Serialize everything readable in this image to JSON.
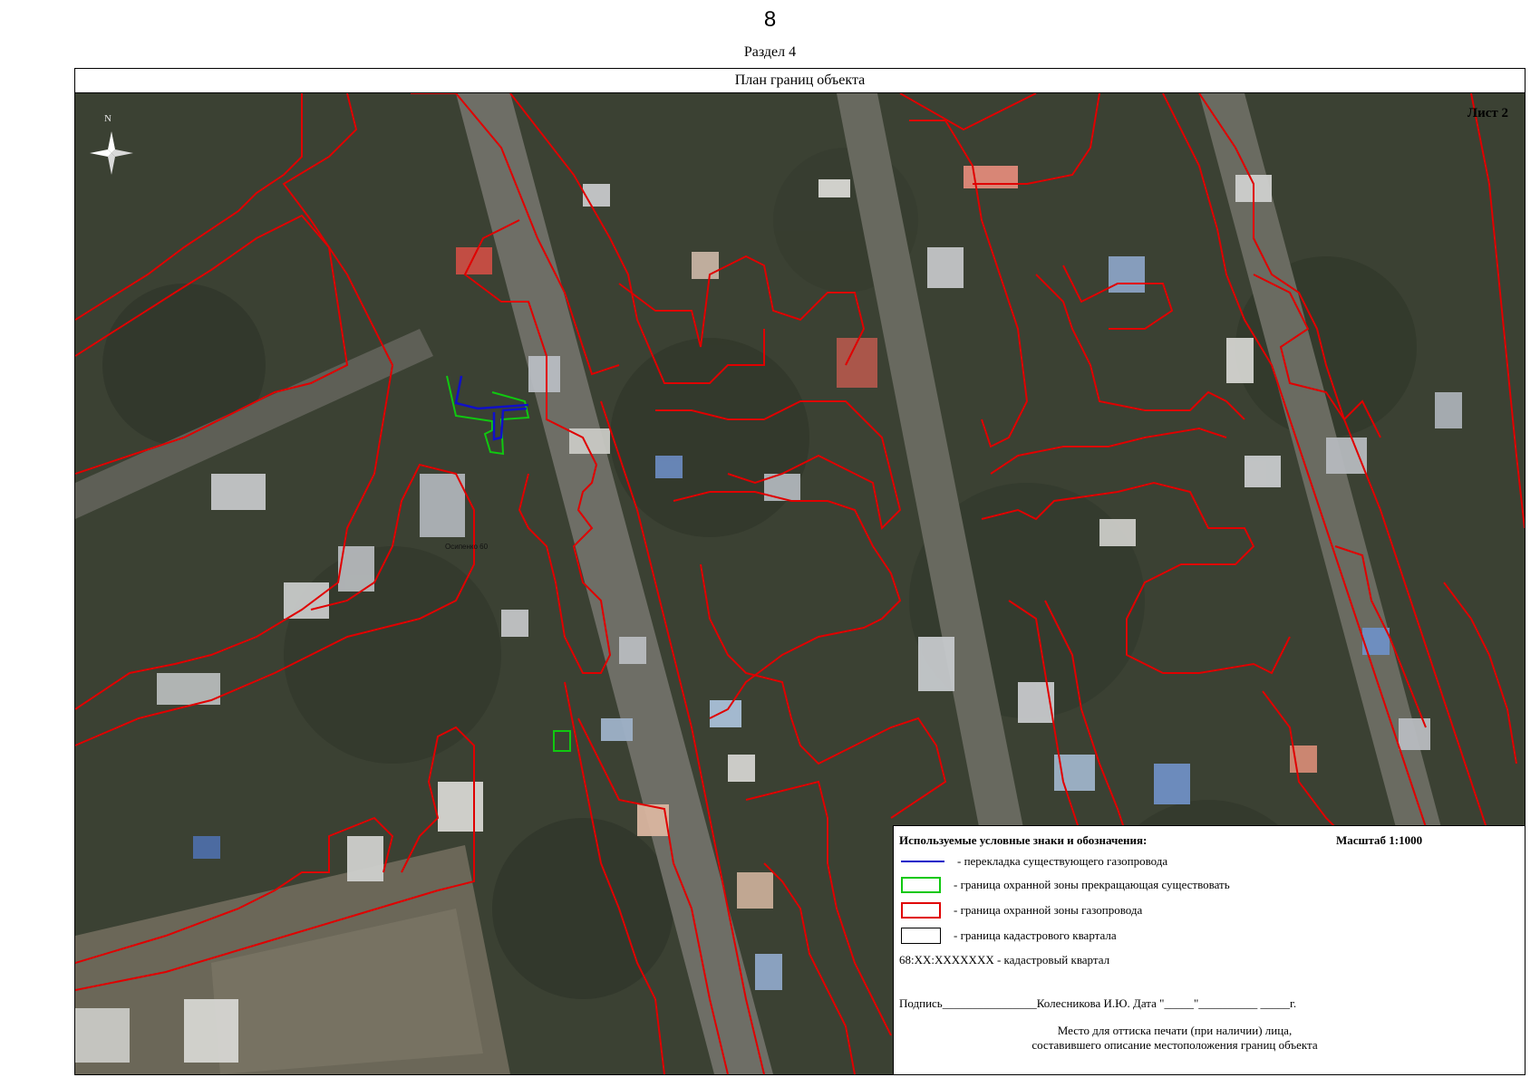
{
  "header": {
    "page_number": "8",
    "section": "Раздел 4",
    "plan_title": "План границ объекта"
  },
  "map": {
    "sheet_label": "Лист 2",
    "north_label": "N",
    "object_label": "Осипенко 60",
    "north_icon": "compass-rose-icon",
    "colors": {
      "gas_relocation": "#1010c8",
      "zone_ceasing": "#10c810",
      "gas_protect_zone": "#e00000",
      "cadastral_block": "#000000"
    }
  },
  "legend": {
    "title": "Используемые условные знаки и обозначения:",
    "scale": "Масштаб 1:1000",
    "items": [
      {
        "label": "- перекладка существующего газопровода"
      },
      {
        "label": "- граница охранной зоны прекращающая существовать"
      },
      {
        "label": "- граница охранной зоны газопровода"
      },
      {
        "label": "- граница кадастрового квартала"
      }
    ],
    "cadastral": "68:ХХ:ХХХХХХХ - кадастровый квартал",
    "signature": "Подпись________________Колесникова И.Ю. Дата \"_____\"__________ _____г.",
    "stamp_line1": "Место для оттиска печати (при наличии) лица,",
    "stamp_line2": "составившего описание местоположения границ объекта"
  }
}
